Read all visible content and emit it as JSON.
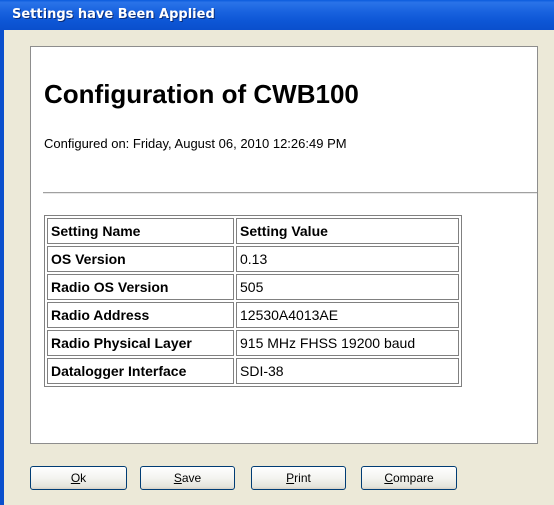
{
  "window": {
    "title": "Settings have Been Applied"
  },
  "report": {
    "title": "Configuration of CWB100",
    "configured_on": "Configured on: Friday, August 06, 2010 12:26:49 PM"
  },
  "table": {
    "headers": [
      "Setting Name",
      "Setting Value"
    ],
    "rows": [
      {
        "name": "OS Version",
        "value": "0.13"
      },
      {
        "name": "Radio OS Version",
        "value": "505"
      },
      {
        "name": "Radio Address",
        "value": "12530A4013AE"
      },
      {
        "name": "Radio Physical Layer",
        "value": "915 MHz FHSS 19200 baud"
      },
      {
        "name": "Datalogger Interface",
        "value": "SDI-38"
      }
    ]
  },
  "buttons": {
    "ok": {
      "mnemonic": "O",
      "rest": "k"
    },
    "save": {
      "mnemonic": "S",
      "rest": "ave"
    },
    "print": {
      "mnemonic": "P",
      "rest": "rint"
    },
    "compare": {
      "mnemonic": "C",
      "rest": "ompare"
    }
  },
  "colors": {
    "titlebar": "#0a4fcd",
    "dialog_bg": "#ece9d8",
    "content_bg": "#ffffff",
    "button_border": "#003c74"
  }
}
